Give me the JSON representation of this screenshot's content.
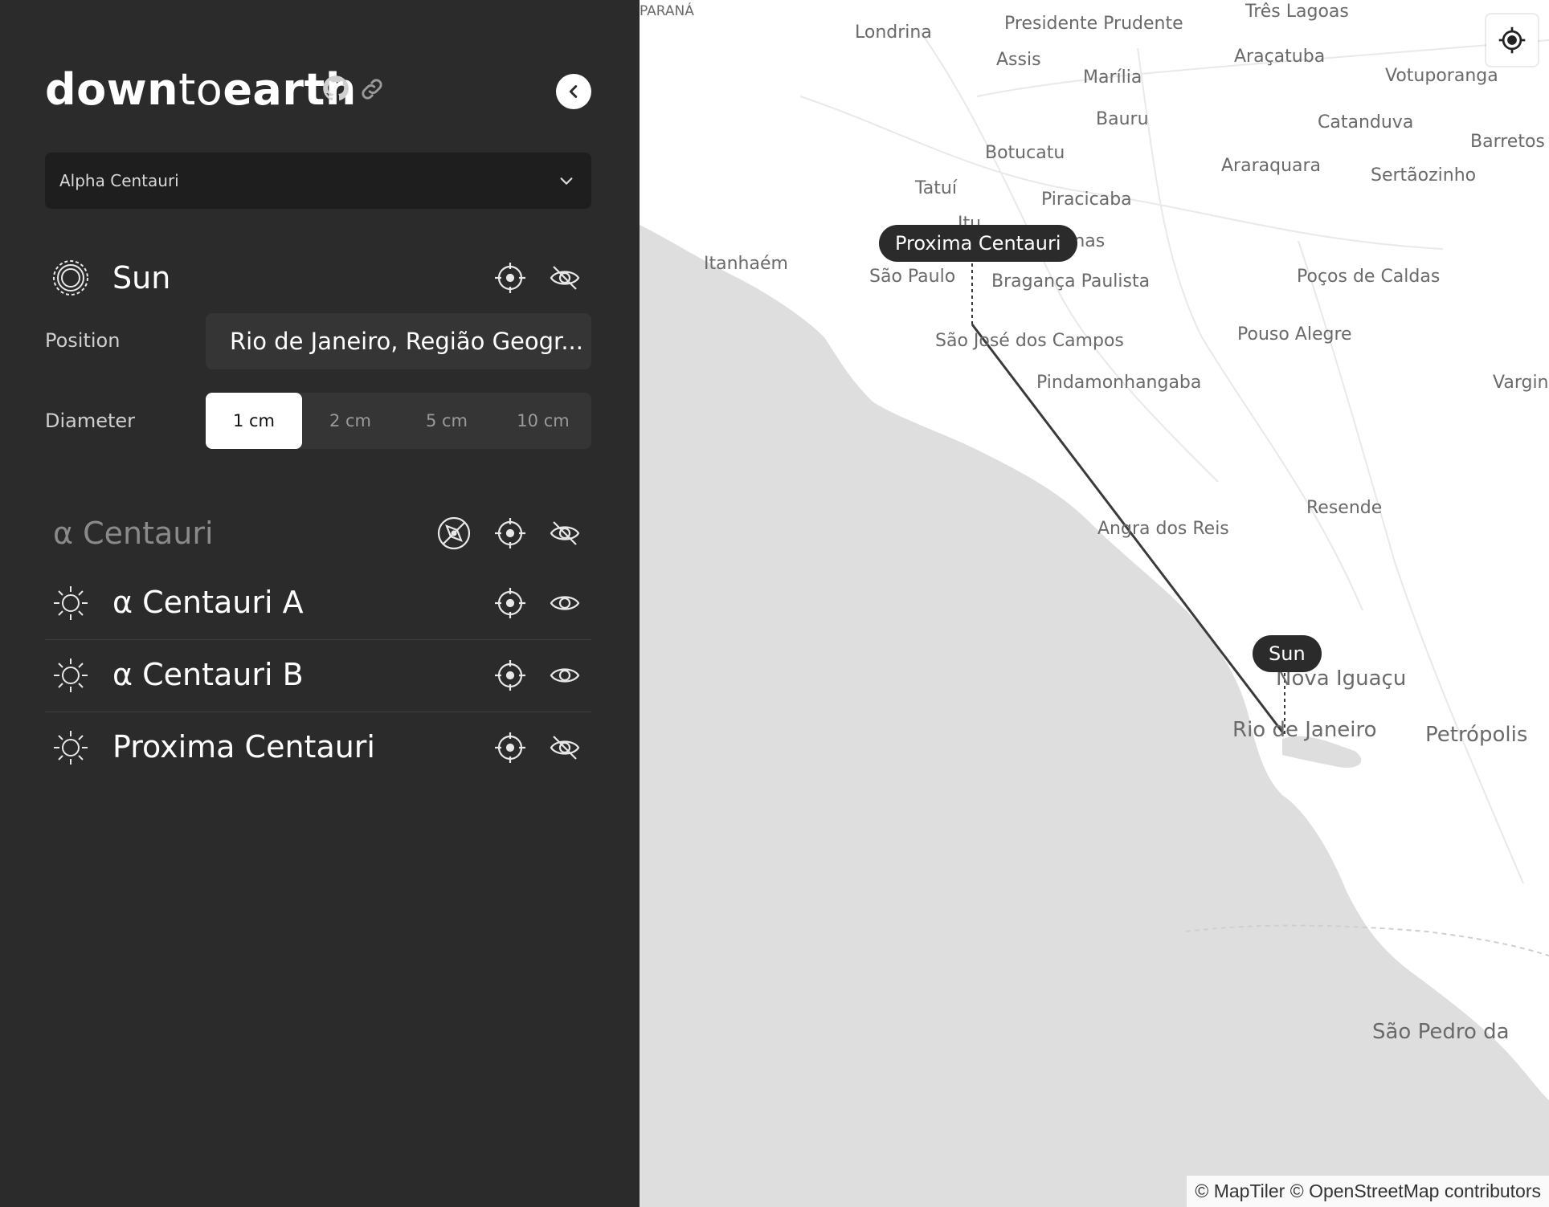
{
  "header": {
    "brand_bold_1": "down",
    "brand_light": "to",
    "brand_bold_2": "earth",
    "github_icon": "github-icon",
    "link_icon": "link-icon",
    "collapse_icon": "chevron-left-icon"
  },
  "system_select": {
    "value": "Alpha Centauri"
  },
  "sun": {
    "title": "Sun",
    "position_label": "Position",
    "position_value": "Rio de Janeiro, Região Geogr...",
    "diameter_label": "Diameter",
    "diameter_options": [
      "1 cm",
      "2 cm",
      "5 cm",
      "10 cm"
    ],
    "diameter_selected": "1 cm"
  },
  "system": {
    "title": "α Centauri",
    "stars": [
      {
        "name": "α Centauri A",
        "visible": true
      },
      {
        "name": "α Centauri B",
        "visible": true
      },
      {
        "name": "Proxima Centauri",
        "visible": false
      }
    ]
  },
  "map": {
    "cities": [
      "PARANÁ",
      "Londrina",
      "Presidente Prudente",
      "Três Lagoas",
      "Assis",
      "Araçatuba",
      "Votuporanga",
      "Marília",
      "Bauru",
      "Catanduva",
      "Barretos",
      "Botucatu",
      "Araraquara",
      "Sertãozinho",
      "Tatuí",
      "Piracicaba",
      "Itu",
      "Campinas",
      "Itanhaém",
      "São Paulo",
      "Bragança Paulista",
      "Poços de Caldas",
      "São José dos Campos",
      "Pouso Alegre",
      "Pindamonhangaba",
      "Varginha",
      "Resende",
      "Angra dos Reis",
      "Nova Iguaçu",
      "Rio de Janeiro",
      "Petrópolis",
      "São Pedro da"
    ],
    "markers": {
      "proxima": "Proxima Centauri",
      "sun": "Sun"
    },
    "attribution": "© MapTiler © OpenStreetMap contributors",
    "colors": {
      "water": "#dcdcdc",
      "land": "#ffffff",
      "line": "#333333"
    }
  }
}
